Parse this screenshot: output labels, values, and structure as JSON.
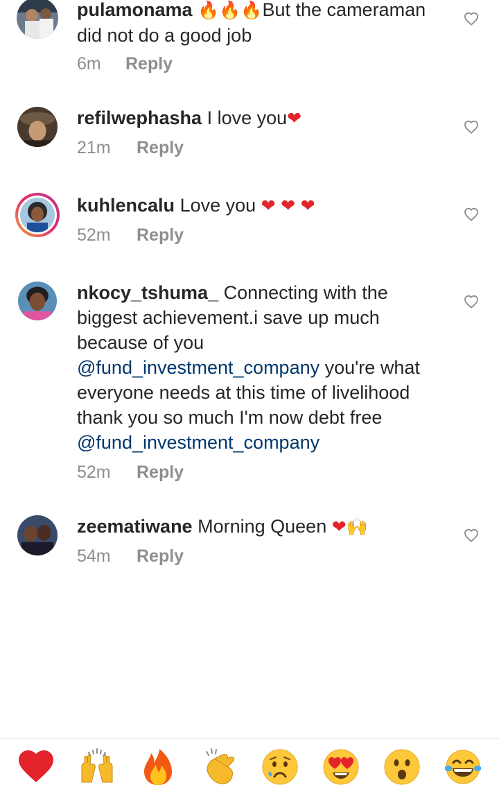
{
  "comments": [
    {
      "username": "pulamonama",
      "emojis": [
        "fire-emoji",
        "fire-emoji",
        "fire-emoji"
      ],
      "text_line1": "But the cameraman",
      "text_line2": "did not do a good job",
      "time": "6m",
      "reply": "Reply"
    },
    {
      "username": "refilwephasha",
      "text": "I love you",
      "emojis": [
        "red-heart-emoji"
      ],
      "time": "21m",
      "reply": "Reply"
    },
    {
      "username": "kuhlencalu",
      "text": "Love you",
      "emojis": [
        "red-heart-emoji",
        "red-heart-emoji",
        "red-heart-emoji"
      ],
      "time": "52m",
      "reply": "Reply"
    },
    {
      "username": "nkocy_tshuma_",
      "text_line1": "Connecting with the",
      "text_line2": "biggest achievement.i save up much",
      "text_line3": "because of you",
      "mention1": "@fund_investment_company",
      "text_line4": "you're what",
      "text_line5": "everyone needs at this time of livelihood",
      "text_line6": "thank you so much I'm now debt free",
      "mention2": "@fund_investment_company",
      "time": "52m",
      "reply": "Reply"
    },
    {
      "username": "zeematiwane",
      "text": "Morning Queen",
      "emojis": [
        "red-heart-emoji",
        "raising-hands-emoji"
      ],
      "time": "54m",
      "reply": "Reply"
    }
  ],
  "reactions": [
    {
      "name": "red-heart-emoji"
    },
    {
      "name": "raising-hands-emoji"
    },
    {
      "name": "fire-emoji"
    },
    {
      "name": "clapping-hands-emoji"
    },
    {
      "name": "sad-face-emoji"
    },
    {
      "name": "heart-eyes-emoji"
    },
    {
      "name": "surprised-face-emoji"
    },
    {
      "name": "tears-of-joy-emoji"
    }
  ],
  "colors": {
    "text": "#262626",
    "secondary": "#8e8e8e",
    "mention": "#00376b",
    "divider": "#dbdbdb"
  }
}
